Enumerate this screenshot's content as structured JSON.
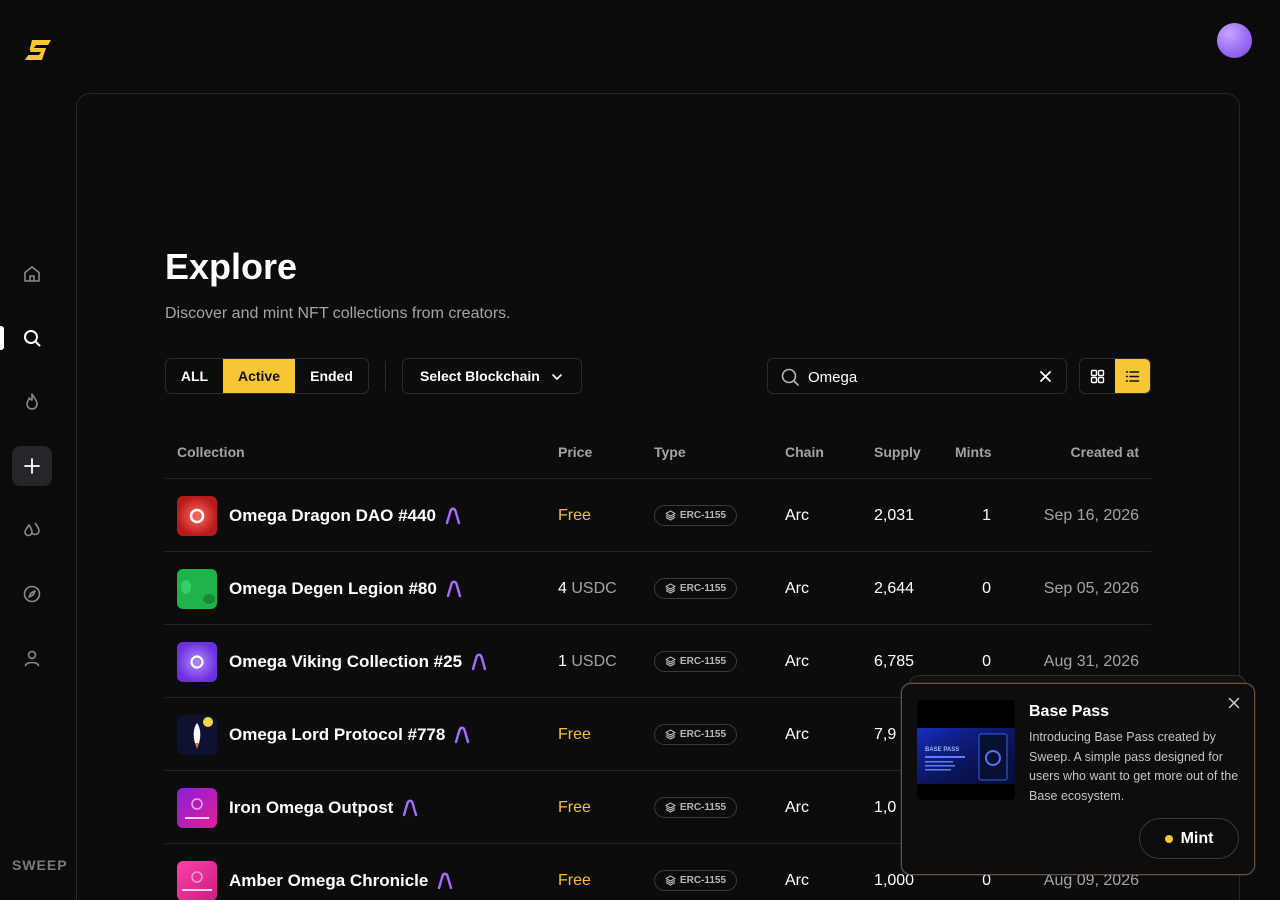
{
  "brand": {
    "wordmark": "SWEEP",
    "accent": "#f7c634"
  },
  "sidebar": {
    "items": [
      {
        "icon": "home-icon"
      },
      {
        "icon": "search-icon",
        "active": true
      },
      {
        "icon": "flame-icon"
      },
      {
        "icon": "plus-icon"
      },
      {
        "icon": "drops-icon"
      },
      {
        "icon": "compass-icon"
      },
      {
        "icon": "user-icon"
      }
    ]
  },
  "page": {
    "title": "Explore",
    "subtitle": "Discover and mint NFT collections from creators."
  },
  "filters": {
    "tabs": [
      "ALL",
      "Active",
      "Ended"
    ],
    "active_tab": "Active",
    "chain_select": "Select Blockchain",
    "search_value": "Omega",
    "view": "list"
  },
  "table": {
    "headers": {
      "collection": "Collection",
      "price": "Price",
      "type": "Type",
      "chain": "Chain",
      "supply": "Supply",
      "mints": "Mints",
      "created": "Created at"
    },
    "rows": [
      {
        "name": "Omega Dragon DAO #440",
        "price_free": "Free",
        "price_num": "",
        "price_unit": "",
        "type": "ERC-1155",
        "chain": "Arc",
        "supply": "2,031",
        "mints": "1",
        "created": "Sep 16, 2026",
        "thumb": "red"
      },
      {
        "name": "Omega Degen Legion #80",
        "price_free": "",
        "price_num": "4",
        "price_unit": "USDC",
        "type": "ERC-1155",
        "chain": "Arc",
        "supply": "2,644",
        "mints": "0",
        "created": "Sep 05, 2026",
        "thumb": "green"
      },
      {
        "name": "Omega Viking Collection #25",
        "price_free": "",
        "price_num": "1",
        "price_unit": "USDC",
        "type": "ERC-1155",
        "chain": "Arc",
        "supply": "6,785",
        "mints": "0",
        "created": "Aug 31, 2026",
        "thumb": "purple"
      },
      {
        "name": "Omega Lord Protocol #778",
        "price_free": "Free",
        "price_num": "",
        "price_unit": "",
        "type": "ERC-1155",
        "chain": "Arc",
        "supply": "7,9",
        "mints": "",
        "created": "",
        "thumb": "rocket"
      },
      {
        "name": "Iron Omega Outpost",
        "price_free": "Free",
        "price_num": "",
        "price_unit": "",
        "type": "ERC-1155",
        "chain": "Arc",
        "supply": "1,0",
        "mints": "",
        "created": "",
        "thumb": "magenta"
      },
      {
        "name": "Amber Omega Chronicle",
        "price_free": "Free",
        "price_num": "",
        "price_unit": "",
        "type": "ERC-1155",
        "chain": "Arc",
        "supply": "1,000",
        "mints": "0",
        "created": "Aug 09, 2026",
        "thumb": "pink"
      }
    ]
  },
  "popup": {
    "title": "Base Pass",
    "description": "Introducing Base Pass created by Sweep. A simple pass designed for users who want to get more out of the Base ecosystem.",
    "cta": "Mint",
    "image_caption": "BASE PASS"
  }
}
